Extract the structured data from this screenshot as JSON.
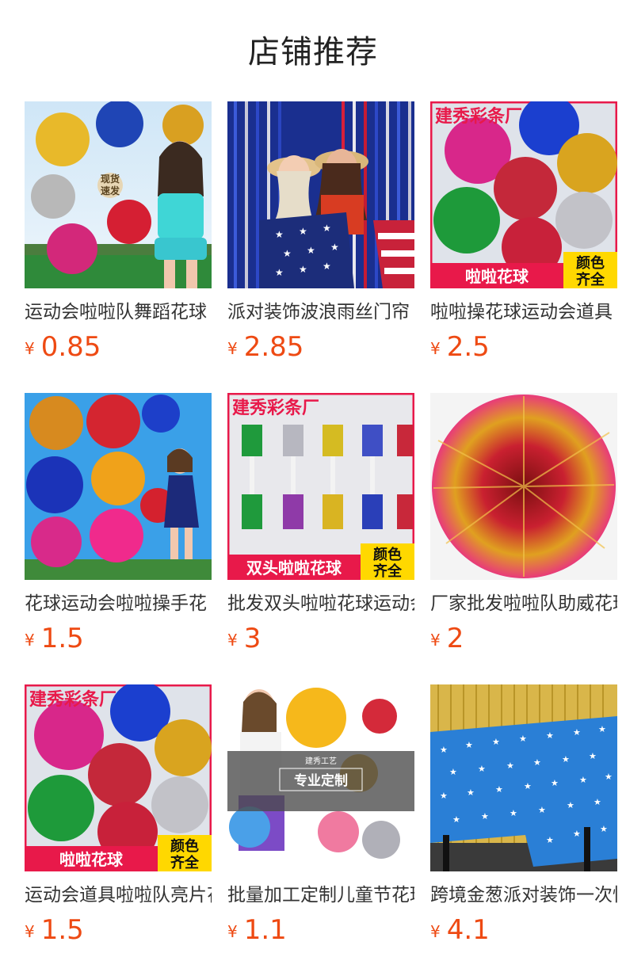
{
  "section": {
    "title": "店铺推荐"
  },
  "currency_symbol": "¥",
  "products": [
    {
      "name": "运动会啦啦队舞蹈花球",
      "price": "0.85",
      "image_icon": "cheerleader-pompom-photo",
      "overlay": {
        "stamp_top": "现货",
        "stamp_bottom": "速发"
      }
    },
    {
      "name": "派对装饰波浪雨丝门帘",
      "price": "2.85",
      "image_icon": "party-tinsel-curtain-photo",
      "overlay": {}
    },
    {
      "name": "啦啦操花球运动会道具",
      "price": "2.5",
      "image_icon": "pompom-assortment-photo",
      "overlay": {
        "brand": "建秀彩条厂",
        "banner": "啦啦花球",
        "corner_top": "颜色",
        "corner_bottom": "齐全"
      }
    },
    {
      "name": "花球运动会啦啦操手花",
      "price": "1.5",
      "image_icon": "pompom-cheerleader-photo",
      "overlay": {}
    },
    {
      "name": "批发双头啦啦花球运动会",
      "price": "3",
      "image_icon": "double-head-pompom-photo",
      "overlay": {
        "brand": "建秀彩条厂",
        "banner": "双头啦啦花球",
        "corner_top": "颜色",
        "corner_bottom": "齐全"
      }
    },
    {
      "name": "厂家批发啦啦队助威花球",
      "price": "2",
      "image_icon": "pompom-closeup-photo",
      "overlay": {}
    },
    {
      "name": "运动会道具啦啦队亮片花球",
      "price": "1.5",
      "image_icon": "pompom-assortment-photo",
      "overlay": {
        "brand": "建秀彩条厂",
        "banner": "啦啦花球",
        "corner_top": "颜色",
        "corner_bottom": "齐全"
      }
    },
    {
      "name": "批量加工定制儿童节花球",
      "price": "1.1",
      "image_icon": "custom-pompom-photo",
      "overlay": {
        "box_small": "建秀工艺",
        "box_main": "专业定制"
      }
    },
    {
      "name": "跨境金葱派对装饰一次性桌布",
      "price": "4.1",
      "image_icon": "star-tablecloth-photo",
      "overlay": {}
    }
  ],
  "colors": {
    "price": "#ee4a13",
    "title": "#222222",
    "name": "#333333",
    "banner_red": "#e8194a",
    "badge_yellow": "#ffd800"
  }
}
